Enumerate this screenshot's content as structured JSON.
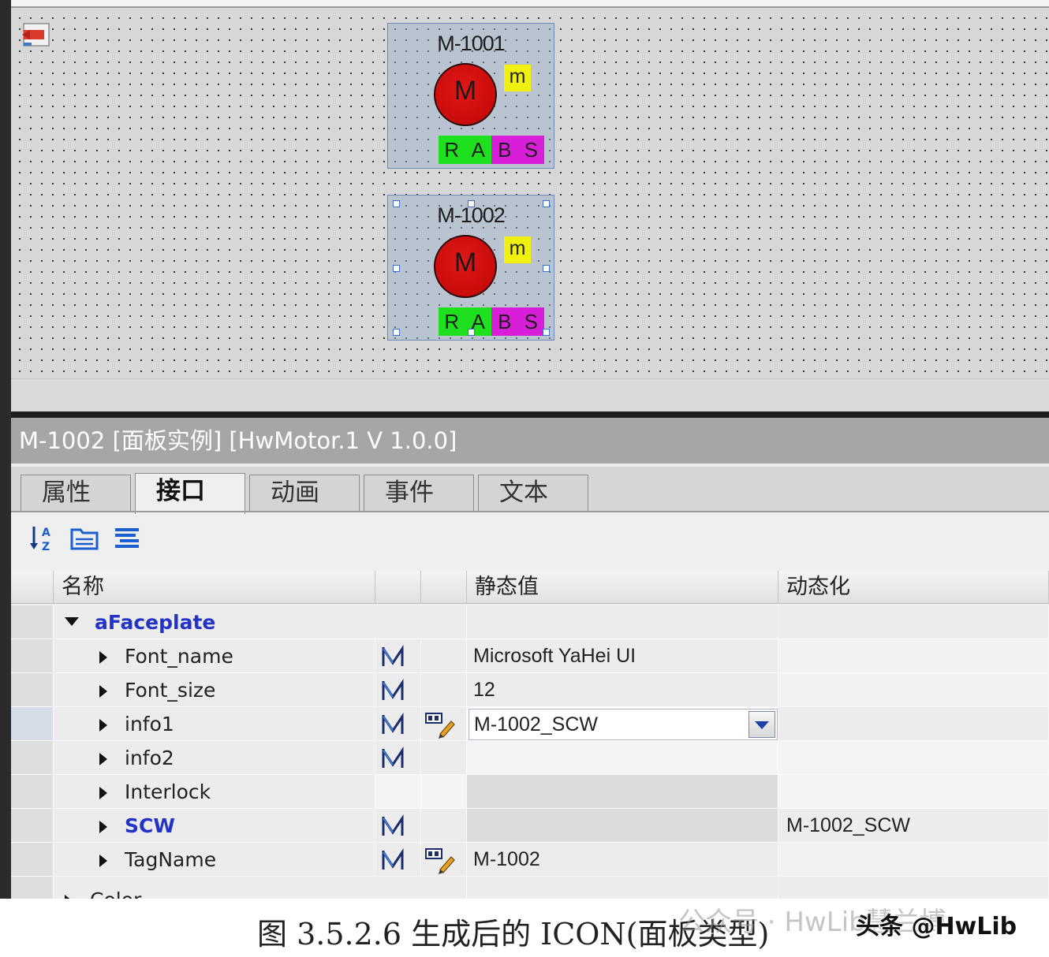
{
  "faceplates": [
    {
      "title": "M-1001",
      "motor_label": "M",
      "mode_label": "m",
      "status": [
        "R",
        "A",
        "B",
        "S"
      ]
    },
    {
      "title": "M-1002",
      "motor_label": "M",
      "mode_label": "m",
      "status": [
        "R",
        "A",
        "B",
        "S"
      ]
    }
  ],
  "panel": {
    "title": "M-1002 [面板实例] [HwMotor.1 V 1.0.0]",
    "tabs": [
      "属性",
      "接口",
      "动画",
      "事件",
      "文本"
    ],
    "active_tab": "接口",
    "columns": {
      "name": "名称",
      "static": "静态值",
      "dynamic": "动态化"
    },
    "group": "aFaceplate",
    "rows": [
      {
        "name": "Font_name",
        "static": "Microsoft YaHei UI",
        "dynamic": ""
      },
      {
        "name": "Font_size",
        "static": "12",
        "dynamic": ""
      },
      {
        "name": "info1",
        "static": "M-1002_SCW",
        "dynamic": ""
      },
      {
        "name": "info2",
        "static": "",
        "dynamic": ""
      },
      {
        "name": "Interlock",
        "static": "",
        "dynamic": ""
      },
      {
        "name": "SCW",
        "static": "",
        "dynamic": "M-1002_SCW"
      },
      {
        "name": "TagName",
        "static": "M-1002",
        "dynamic": ""
      },
      {
        "name": "Color",
        "static": "",
        "dynamic": ""
      }
    ]
  },
  "caption": "图 3.5.2.6  生成后的 ICON(面板类型)",
  "watermark": {
    "faint": "公众号 · HwLib慧兰博",
    "bold": "头条 @HwLib"
  },
  "colors": {
    "motor_red": "#d01010",
    "mode_yellow": "#f0f010",
    "status_green": "#1fe01f",
    "status_magenta": "#d81ed8",
    "link_blue": "#2433c7"
  }
}
